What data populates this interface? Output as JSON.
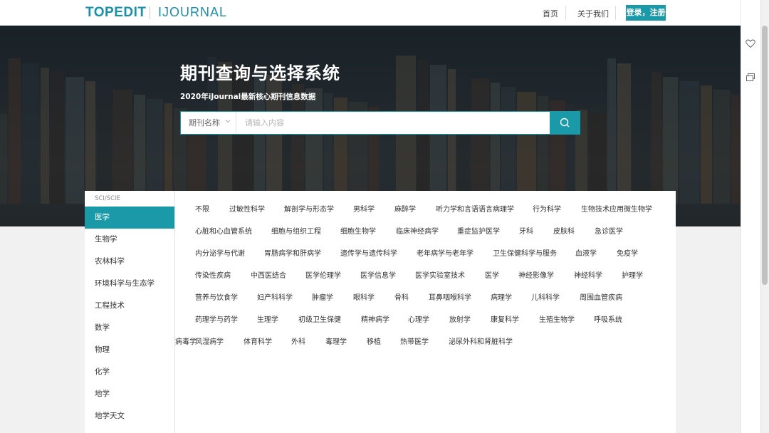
{
  "header": {
    "logo_main": "TOPEDIT",
    "logo_sub": "IJOURNAL",
    "nav_home": "首页",
    "nav_about": "关于我们",
    "login": "登录，注册"
  },
  "hero": {
    "title": "期刊查询与选择系统",
    "subtitle": "2020年iJournal最新核心期刊信息数据",
    "search_field": "期刊名称",
    "search_placeholder": "请输入内容"
  },
  "sidebar": {
    "group": "SCI/SCIE",
    "items": [
      "医学",
      "生物学",
      "农林科学",
      "环境科学与生态学",
      "工程技术",
      "数学",
      "物理",
      "化学",
      "地学",
      "地学天文"
    ],
    "active_index": 0
  },
  "subjects": [
    [
      "不限",
      "过敏性科学",
      "解剖学与形态学",
      "男科学",
      "麻醉学",
      "听力学和言语语言病理学",
      "行为科学",
      "生物技术应用微生物学"
    ],
    [
      "心脏和心血管系统",
      "细胞与组织工程",
      "细胞生物学",
      "临床神经病学",
      "重症监护医学",
      "牙科",
      "皮肤科",
      "急诊医学"
    ],
    [
      "内分泌学与代谢",
      "胃肠病学和肝病学",
      "遗传学与遗传科学",
      "老年病学与老年学",
      "卫生保健科学与服务",
      "血液学",
      "免疫学"
    ],
    [
      "传染性疾病",
      "中西医结合",
      "医学伦理学",
      "医学信息学",
      "医学实验室技术",
      "医学",
      "神经影像学",
      "神经科学",
      "护理学"
    ],
    [
      "营养与饮食学",
      "妇产科科学",
      "肿瘤学",
      "眼科学",
      "骨科",
      "耳鼻咽喉科学",
      "病理学",
      "儿科科学",
      "周围血管疾病"
    ],
    [
      "药理学与药学",
      "生理学",
      "初级卫生保健",
      "精神病学",
      "心理学",
      "放射学",
      "康复科学",
      "生殖生物学",
      "呼吸系统"
    ],
    [
      "风湿病学",
      "体育科学",
      "外科",
      "毒理学",
      "移植",
      "热带医学",
      "泌尿外科和肾脏科学",
      "病毒学"
    ]
  ],
  "colors": {
    "accent": "#1a9aa8",
    "logo": "#1790a8"
  }
}
